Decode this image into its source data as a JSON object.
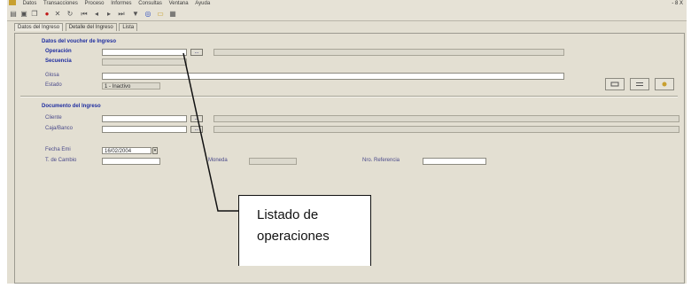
{
  "menubar": {
    "items": [
      "Datos",
      "Transacciones",
      "Proceso",
      "Informes",
      "Consultas",
      "Ventana",
      "Ayuda"
    ],
    "corner": "- 8 X"
  },
  "toolbar": {
    "icons": [
      "print-icon",
      "save-icon",
      "copy-icon",
      "delete-icon",
      "cancel-icon",
      "refresh-icon",
      "first-icon",
      "prev-icon",
      "next-icon",
      "last-icon",
      "filter-icon",
      "find-icon",
      "open-icon",
      "exit-icon"
    ]
  },
  "tabs": [
    "Datos del Ingreso",
    "Detalle del Ingreso",
    "Lista"
  ],
  "section1": {
    "title": "Datos del voucher de Ingreso",
    "operacion_label": "Operación",
    "secuencia_label": "Secuencia",
    "glosa_label": "Glosa",
    "estado_label": "Estado",
    "estado_value": "1 - Inactivo"
  },
  "section2": {
    "title": "Documento del Ingreso",
    "cliente_label": "Cliente",
    "caja_label": "Caja/Banco",
    "fecha_label": "Fecha Emi",
    "fecha_value": "16/02/2004",
    "tcambio_label": "T. de Cambio",
    "moneda_label": "Moneda",
    "referencia_label": "Nro. Referencia"
  },
  "lookup_label": "...",
  "callout": {
    "line1": "Listado de",
    "line2": "operaciones"
  },
  "colors": {
    "window_bg": "#e3dfd2",
    "section_title": "#1f2ea0",
    "callout_border": "#111111"
  }
}
